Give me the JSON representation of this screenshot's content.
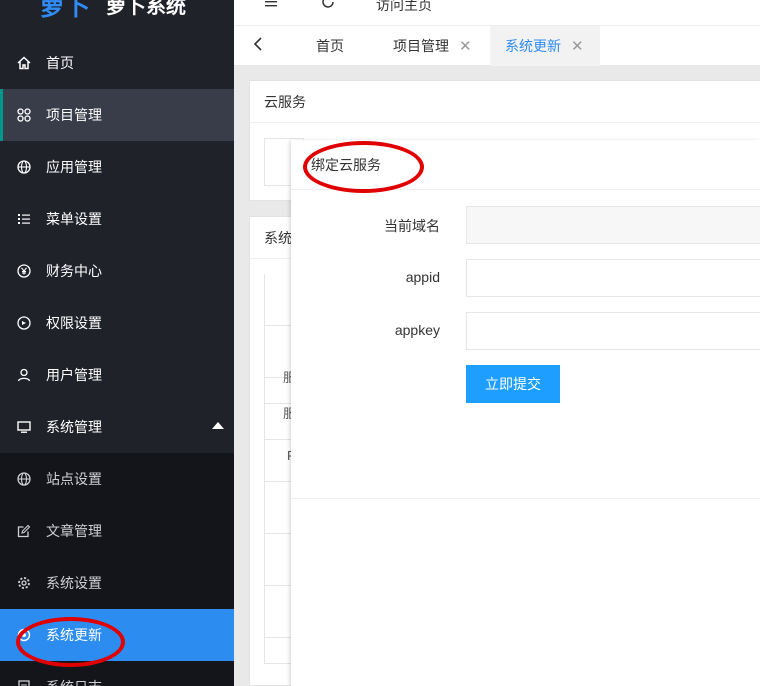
{
  "brand": {
    "mark": "萝卜",
    "name": "萝卜系统"
  },
  "header": {
    "visit_home": "访问主页",
    "menu_icon": "menu-icon",
    "refresh_icon": "refresh-icon"
  },
  "sidebar": {
    "items": [
      {
        "label": "首页",
        "icon": "home-icon"
      },
      {
        "label": "项目管理",
        "icon": "grid-icon"
      },
      {
        "label": "应用管理",
        "icon": "globe-icon"
      },
      {
        "label": "菜单设置",
        "icon": "list-icon"
      },
      {
        "label": "财务中心",
        "icon": "yen-icon"
      },
      {
        "label": "权限设置",
        "icon": "clock-icon"
      },
      {
        "label": "用户管理",
        "icon": "user-icon"
      },
      {
        "label": "系统管理",
        "icon": "monitor-icon"
      }
    ],
    "sub_items": [
      {
        "label": "站点设置",
        "icon": "globe-icon"
      },
      {
        "label": "文章管理",
        "icon": "edit-icon"
      },
      {
        "label": "系统设置",
        "icon": "gear-icon"
      },
      {
        "label": "系统更新",
        "icon": "circle-icon"
      },
      {
        "label": "系统日志",
        "icon": "doc-icon"
      }
    ]
  },
  "tabs": {
    "items": [
      {
        "label": "首页",
        "closable": false
      },
      {
        "label": "项目管理",
        "closable": true
      },
      {
        "label": "系统更新",
        "closable": true
      }
    ],
    "close_glyph": "✕"
  },
  "background": {
    "cloud_card_title": "云服务",
    "system_card_title": "系统",
    "row_stubs": [
      "",
      "",
      "服",
      "服",
      "P",
      "",
      "",
      "",
      ""
    ]
  },
  "modal": {
    "title": "绑定云服务",
    "fields": [
      {
        "label": "当前域名",
        "value": "",
        "readonly": true
      },
      {
        "label": "appid",
        "value": "",
        "readonly": false
      },
      {
        "label": "appkey",
        "value": "",
        "readonly": false
      }
    ],
    "submit_label": "立即提交"
  },
  "colors": {
    "sidebar_bg": "#20222a",
    "active_blue": "#2d8cf0",
    "submit_blue": "#1e9fff",
    "annotation_red": "#e00000"
  }
}
